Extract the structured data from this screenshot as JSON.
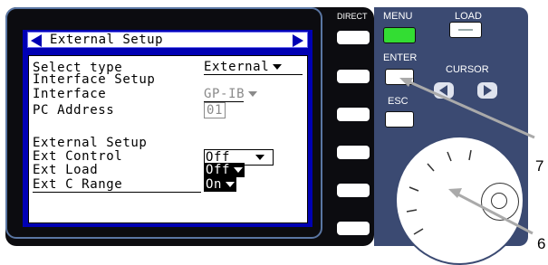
{
  "screen": {
    "title": "External Setup",
    "rows": [
      {
        "label": "Select type",
        "value": "External"
      },
      {
        "label": "Interface Setup"
      },
      {
        "label": " Interface",
        "value": "GP-IB"
      },
      {
        "label": " PC Address",
        "value": "01"
      },
      {
        "label": "External Setup"
      },
      {
        "label": " Ext Control",
        "value": "Off"
      },
      {
        "label": " Ext Load",
        "value": "Off"
      },
      {
        "label": " Ext C Range",
        "value": "On"
      }
    ]
  },
  "panel": {
    "direct_label": "DIRECT",
    "menu_label": "MENU",
    "load_label": "LOAD",
    "enter_label": "ENTER",
    "cursor_label": "CURSOR",
    "esc_label": "ESC"
  },
  "callouts": {
    "enter": "7",
    "dial": "6"
  },
  "colors": {
    "screen_blue": "#0000b4",
    "panel_blue": "#3b4a72",
    "menu_led": "#33dd33"
  }
}
